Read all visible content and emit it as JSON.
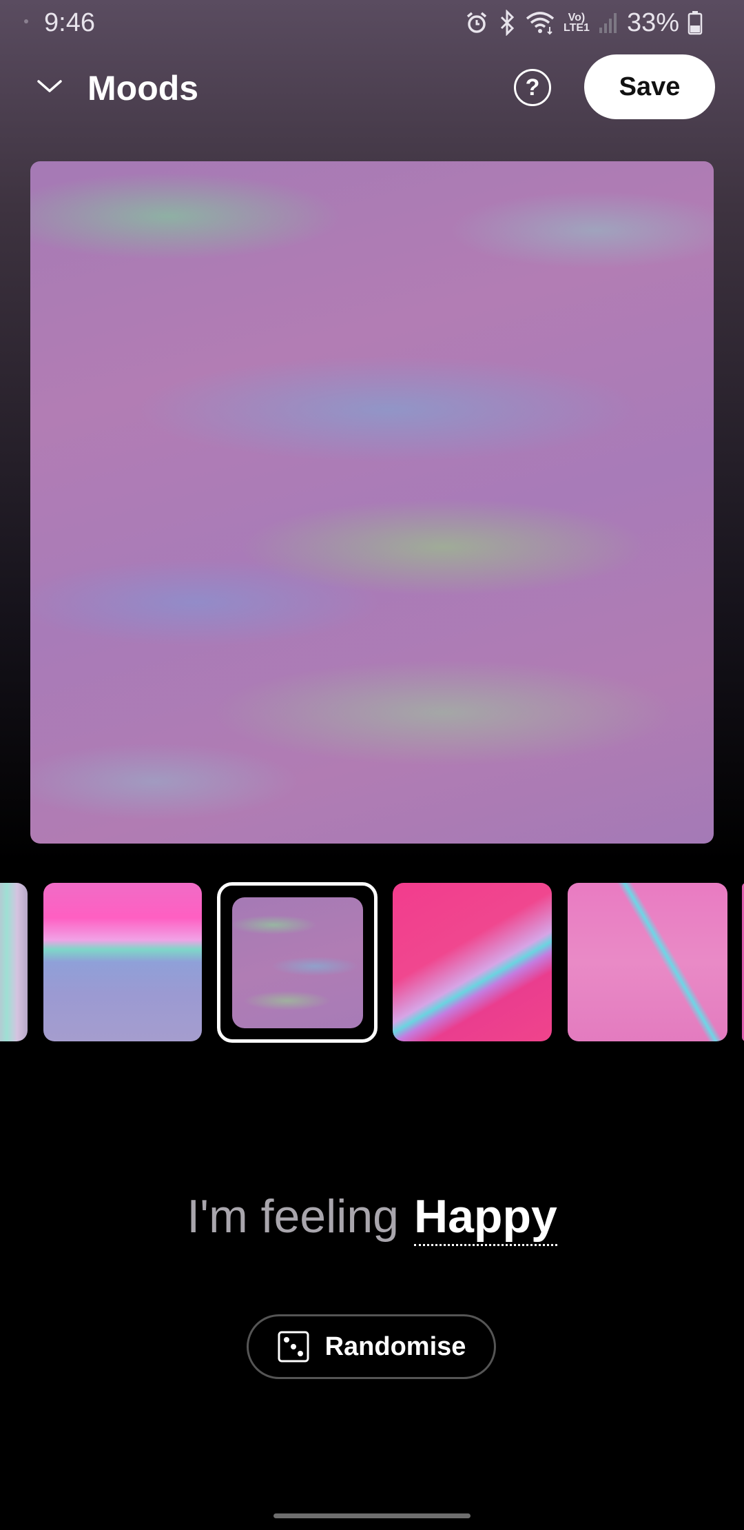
{
  "status_bar": {
    "time": "9:46",
    "network_label_top": "Vo)",
    "network_label_bottom": "LTE1",
    "battery_percent": "33%",
    "icons": [
      "alarm-icon",
      "bluetooth-icon",
      "wifi-icon",
      "signal-icon",
      "battery-icon"
    ]
  },
  "header": {
    "title": "Moods",
    "help_label": "?",
    "save_label": "Save",
    "collapse_icon": "chevron-down-icon"
  },
  "thumbnails": {
    "selected_index": 2,
    "count_visible": 6
  },
  "mood": {
    "prefix": "I'm feeling",
    "value": "Happy"
  },
  "randomise": {
    "label": "Randomise",
    "icon": "dice-icon"
  },
  "colors": {
    "background": "#000000",
    "accent_white": "#ffffff",
    "muted_text": "#a9a6ad"
  }
}
